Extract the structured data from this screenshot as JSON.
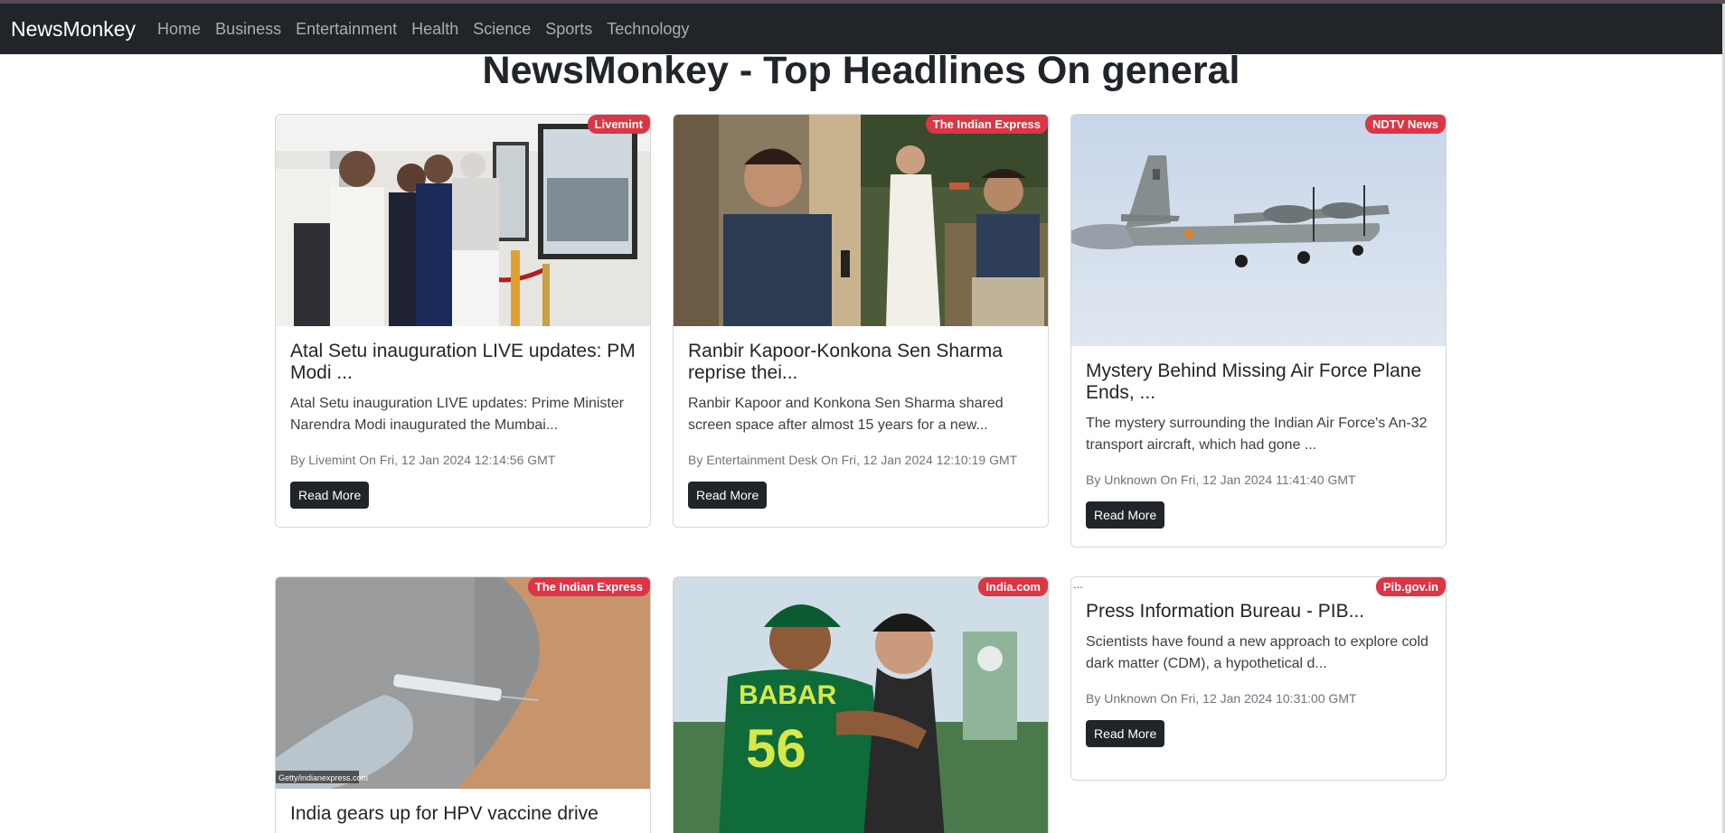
{
  "navbar": {
    "brand": "NewsMonkey",
    "links": [
      "Home",
      "Business",
      "Entertainment",
      "Health",
      "Science",
      "Sports",
      "Technology"
    ]
  },
  "page_title": "NewsMonkey - Top Headlines On general",
  "cards": [
    {
      "source": "Livemint",
      "title": "Atal Setu inauguration LIVE updates: PM Modi ...",
      "description": "Atal Setu inauguration LIVE updates: Prime Minister Narendra Modi inaugurated the Mumbai...",
      "meta": "By Livemint On Fri, 12 Jan 2024 12:14:56 GMT",
      "button": "Read More"
    },
    {
      "source": "The Indian Express",
      "title": "Ranbir Kapoor-Konkona Sen Sharma reprise thei...",
      "description": "Ranbir Kapoor and Konkona Sen Sharma shared screen space after almost 15 years for a new...",
      "meta": "By Entertainment Desk On Fri, 12 Jan 2024 12:10:19 GMT",
      "button": "Read More"
    },
    {
      "source": "NDTV News",
      "title": "Mystery Behind Missing Air Force Plane Ends, ...",
      "description": "The mystery surrounding the Indian Air Force's An-32 transport aircraft, which had gone ...",
      "meta": "By Unknown On Fri, 12 Jan 2024 11:41:40 GMT",
      "button": "Read More"
    },
    {
      "source": "The Indian Express",
      "title": "India gears up for HPV vaccine drive",
      "watermark": "Getty/indianexpress.com"
    },
    {
      "source": "India.com",
      "jersey_text": "BABAR",
      "jersey_number": "56"
    },
    {
      "source": "Pib.gov.in",
      "broken_image_alt": "...",
      "title": "Press Information Bureau - PIB...",
      "description": "Scientists have found a new approach to explore cold dark matter (CDM), a hypothetical d...",
      "meta": "By Unknown On Fri, 12 Jan 2024 10:31:00 GMT",
      "button": "Read More"
    }
  ]
}
